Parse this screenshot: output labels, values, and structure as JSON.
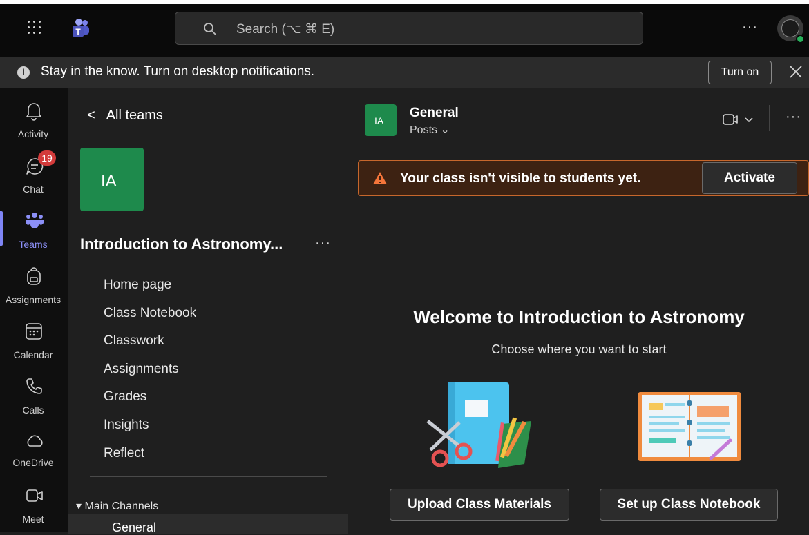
{
  "topbar": {
    "search_placeholder": "Search (⌥ ⌘ E)",
    "more_label": "···"
  },
  "notification": {
    "message": "Stay in the know. Turn on desktop notifications.",
    "info_glyph": "i",
    "turn_on_label": "Turn on"
  },
  "rail": {
    "items": [
      {
        "label": "Activity",
        "icon": "bell-icon"
      },
      {
        "label": "Chat",
        "icon": "chat-icon",
        "badge": "19"
      },
      {
        "label": "Teams",
        "icon": "teams-icon",
        "active": true
      },
      {
        "label": "Assignments",
        "icon": "backpack-icon"
      },
      {
        "label": "Calendar",
        "icon": "calendar-icon"
      },
      {
        "label": "Calls",
        "icon": "phone-icon"
      },
      {
        "label": "OneDrive",
        "icon": "cloud-icon"
      },
      {
        "label": "Meet",
        "icon": "video-icon"
      }
    ]
  },
  "team_pane": {
    "back_label": "All teams",
    "team_initials": "IA",
    "team_name": "Introduction to Astronomy...",
    "more_label": "···",
    "nav": [
      "Home page",
      "Class Notebook",
      "Classwork",
      "Assignments",
      "Grades",
      "Insights",
      "Reflect"
    ],
    "channels_header": "Main Channels",
    "channels": [
      "General"
    ]
  },
  "main": {
    "channel_initials": "IA",
    "channel_title": "General",
    "channel_tab": "Posts",
    "more_label": "···",
    "alert_text": "Your class isn't visible to students yet.",
    "activate_label": "Activate",
    "welcome_title": "Welcome to Introduction to Astronomy",
    "welcome_subtitle": "Choose where you want to start",
    "upload_label": "Upload Class Materials",
    "notebook_label": "Set up Class Notebook"
  },
  "colors": {
    "accent": "#7f85f5",
    "team_tile": "#1e8a4c",
    "alert_border": "#c7672c",
    "alert_bg": "#3d2212",
    "badge": "#d33b3b"
  }
}
